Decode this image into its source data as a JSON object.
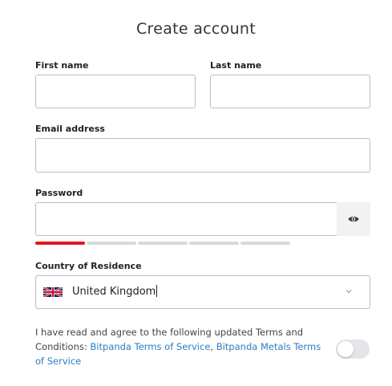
{
  "title": "Create account",
  "fields": {
    "first_name": {
      "label": "First name",
      "value": ""
    },
    "last_name": {
      "label": "Last name",
      "value": ""
    },
    "email": {
      "label": "Email address",
      "value": ""
    },
    "password": {
      "label": "Password",
      "value": ""
    },
    "country": {
      "label": "Country of Residence",
      "value": "United Kingdom"
    }
  },
  "password_strength": {
    "filled_segments": 1,
    "total_segments": 5
  },
  "terms": {
    "prefix": "I have read and agree to the following updated Terms and Conditions: ",
    "link1": "Bitpanda Terms of Service",
    "separator": ", ",
    "link2": "Bitpanda Metals Terms of Service",
    "accepted": false
  },
  "icons": {
    "password_toggle": "eye-icon",
    "country_flag": "uk-flag-icon",
    "dropdown": "chevron-down-icon"
  },
  "colors": {
    "strength_active": "#e8141d",
    "strength_inactive": "#d9d9d9",
    "link": "#2d7cc1"
  }
}
